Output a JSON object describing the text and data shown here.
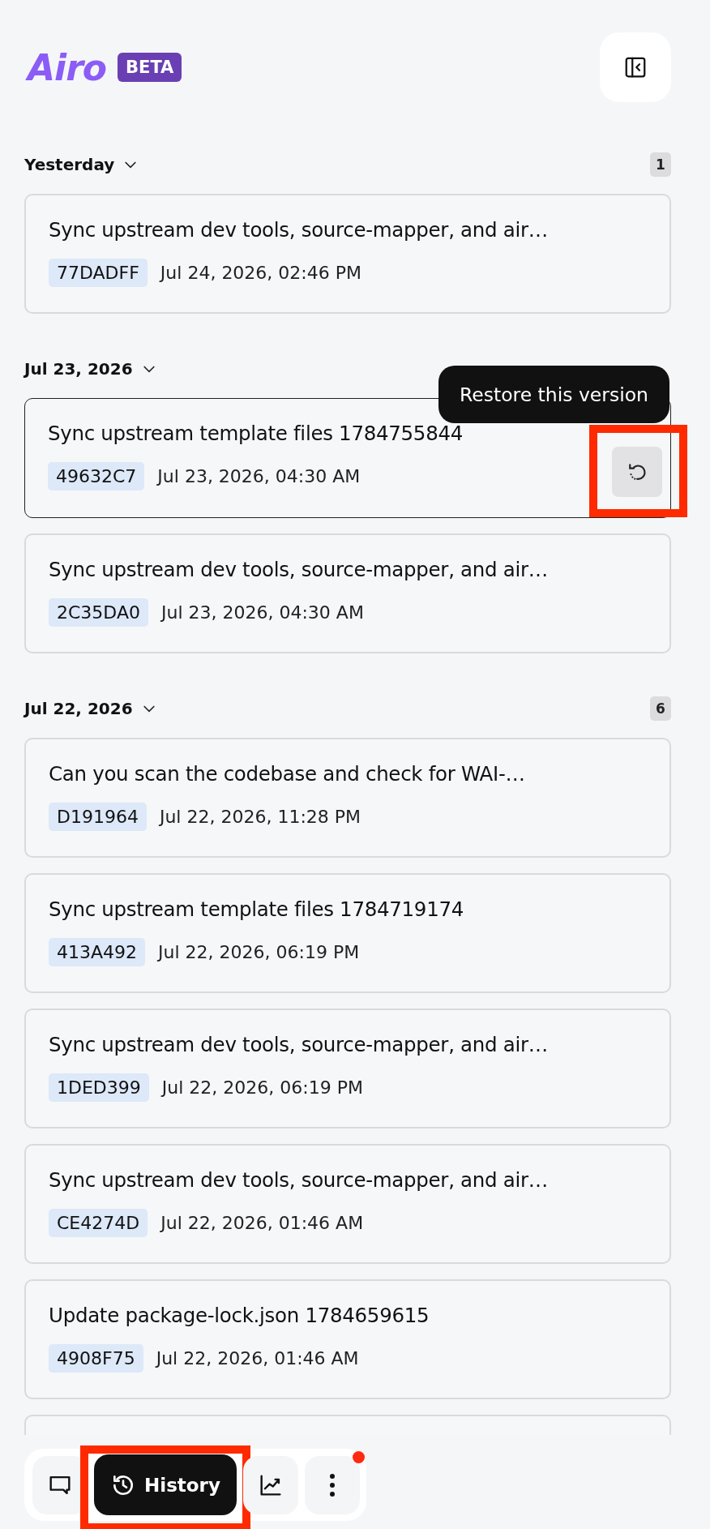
{
  "brand": {
    "name": "Airo",
    "badge": "BETA"
  },
  "groups": [
    {
      "label": "Yesterday",
      "expanded": true,
      "count": "1",
      "versions": [
        {
          "kind": "version",
          "title": "Sync upstream dev tools, source-mapper, and air…",
          "hash": "77DADFF",
          "time": "Jul 24, 2026, 02:46 PM",
          "selected": false,
          "highlighted": false
        }
      ]
    },
    {
      "label": "Jul 23, 2026",
      "expanded": true,
      "versions": [
        {
          "kind": "version",
          "title": "Sync upstream template files 1784755844",
          "hash": "49632C7",
          "time": "Jul 23, 2026, 04:30 AM",
          "selected": true,
          "highlighted": true,
          "tooltip": "Restore this version"
        },
        {
          "kind": "version",
          "title": "Sync upstream dev tools, source-mapper, and air…",
          "hash": "2C35DA0",
          "time": "Jul 23, 2026, 04:30 AM",
          "selected": false,
          "highlighted": false
        }
      ]
    },
    {
      "label": "Jul 22, 2026",
      "expanded": true,
      "count": "6",
      "versions": [
        {
          "kind": "version",
          "title": "Can you scan the codebase and check for WAI-…",
          "hash": "D191964",
          "time": "Jul 22, 2026, 11:28 PM",
          "selected": false,
          "highlighted": false
        },
        {
          "kind": "version",
          "title": "Sync upstream template files 1784719174",
          "hash": "413A492",
          "time": "Jul 22, 2026, 06:19 PM",
          "selected": false,
          "highlighted": false
        },
        {
          "kind": "version",
          "title": "Sync upstream dev tools, source-mapper, and air…",
          "hash": "1DED399",
          "time": "Jul 22, 2026, 06:19 PM",
          "selected": false,
          "highlighted": false
        },
        {
          "kind": "version",
          "title": "Sync upstream dev tools, source-mapper, and air…",
          "hash": "CE4274D",
          "time": "Jul 22, 2026, 01:46 AM",
          "selected": false,
          "highlighted": false
        },
        {
          "kind": "version",
          "title": "Update package-lock.json 1784659615",
          "hash": "4908F75",
          "time": "Jul 22, 2026, 01:46 AM",
          "selected": false,
          "highlighted": false
        },
        {
          "kind": "cut"
        }
      ]
    }
  ],
  "nav": [
    {
      "kind": "chat",
      "selected": false,
      "highlighted": false
    },
    {
      "kind": "history",
      "label": "History",
      "selected": true,
      "highlighted": true
    },
    {
      "kind": "chart",
      "selected": false,
      "highlighted": false
    },
    {
      "kind": "more",
      "selected": false,
      "highlighted": false,
      "notification": true
    }
  ]
}
